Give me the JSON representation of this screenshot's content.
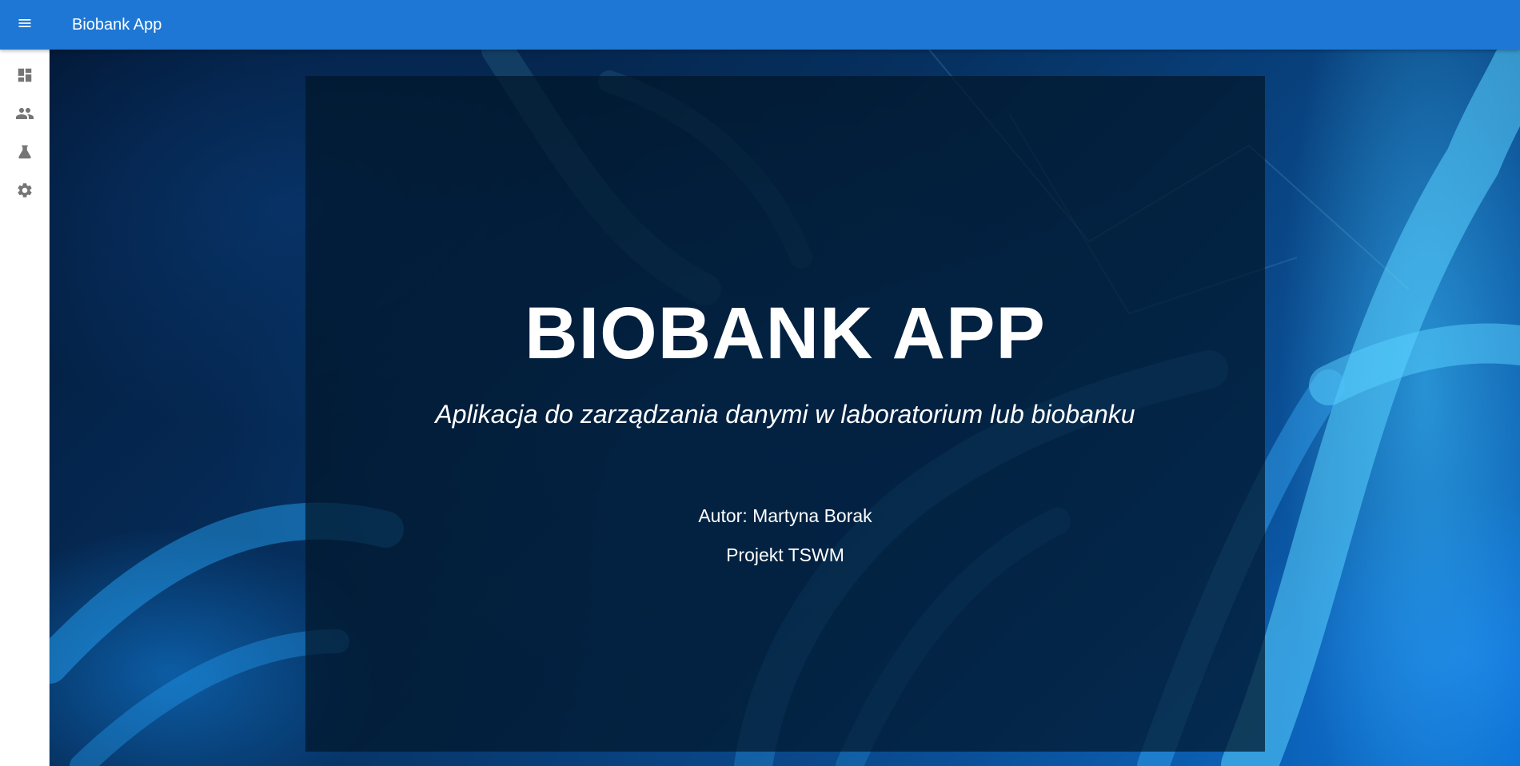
{
  "app_bar": {
    "title": "Biobank App",
    "menu_icon": "menu-icon",
    "color": "#1e77d4"
  },
  "drawer": {
    "items": [
      {
        "icon": "dashboard-icon"
      },
      {
        "icon": "people-icon"
      },
      {
        "icon": "flask-icon"
      },
      {
        "icon": "gear-icon"
      }
    ]
  },
  "hero": {
    "title": "BIOBANK APP",
    "subtitle": "Aplikacja do zarządzania danymi w laboratorium lub biobanku",
    "author": "Autor: Martyna Borak",
    "project": "Projekt TSWM"
  }
}
